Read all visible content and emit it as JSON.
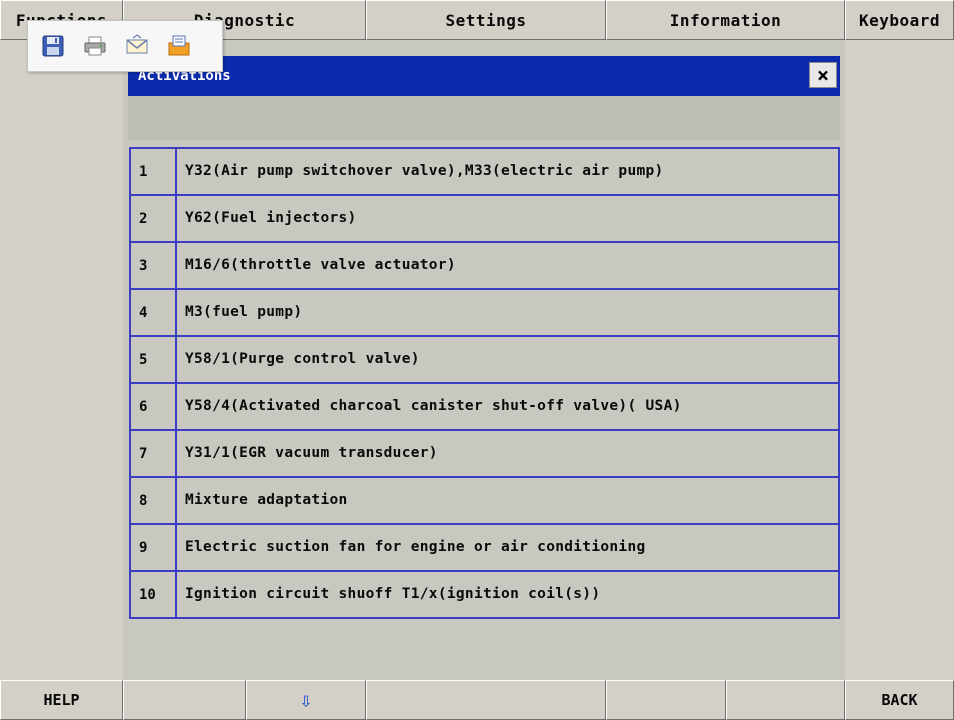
{
  "top_tabs": [
    "Functions",
    "Diagnostic",
    "Settings",
    "Information",
    "Keyboard"
  ],
  "dialog": {
    "title": "Activations",
    "close_label": "×"
  },
  "items": [
    {
      "num": "1",
      "label": "Y32(Air pump switchover valve),M33(electric air pump)"
    },
    {
      "num": "2",
      "label": "Y62(Fuel injectors)"
    },
    {
      "num": "3",
      "label": "M16/6(throttle valve actuator)"
    },
    {
      "num": "4",
      "label": "M3(fuel pump)"
    },
    {
      "num": "5",
      "label": "Y58/1(Purge control valve)"
    },
    {
      "num": "6",
      "label": "Y58/4(Activated charcoal canister shut-off valve)( USA)"
    },
    {
      "num": "7",
      "label": "Y31/1(EGR vacuum transducer)"
    },
    {
      "num": "8",
      "label": "Mixture adaptation"
    },
    {
      "num": "9",
      "label": "Electric suction fan for engine or air conditioning"
    },
    {
      "num": "10",
      "label": "Ignition circuit shuoff T1/x(ignition coil(s))"
    }
  ],
  "bottom_bar": {
    "help_label": "HELP",
    "down_arrow": "⇩",
    "back_label": "BACK"
  },
  "toolbar_icons": [
    "save-icon",
    "print-icon",
    "email-icon",
    "export-icon"
  ],
  "colors": {
    "title_bar": "#0c2bac",
    "row_border": "#3d3dc4",
    "panel": "#c8c8c0",
    "chrome": "#d4d0c8"
  }
}
